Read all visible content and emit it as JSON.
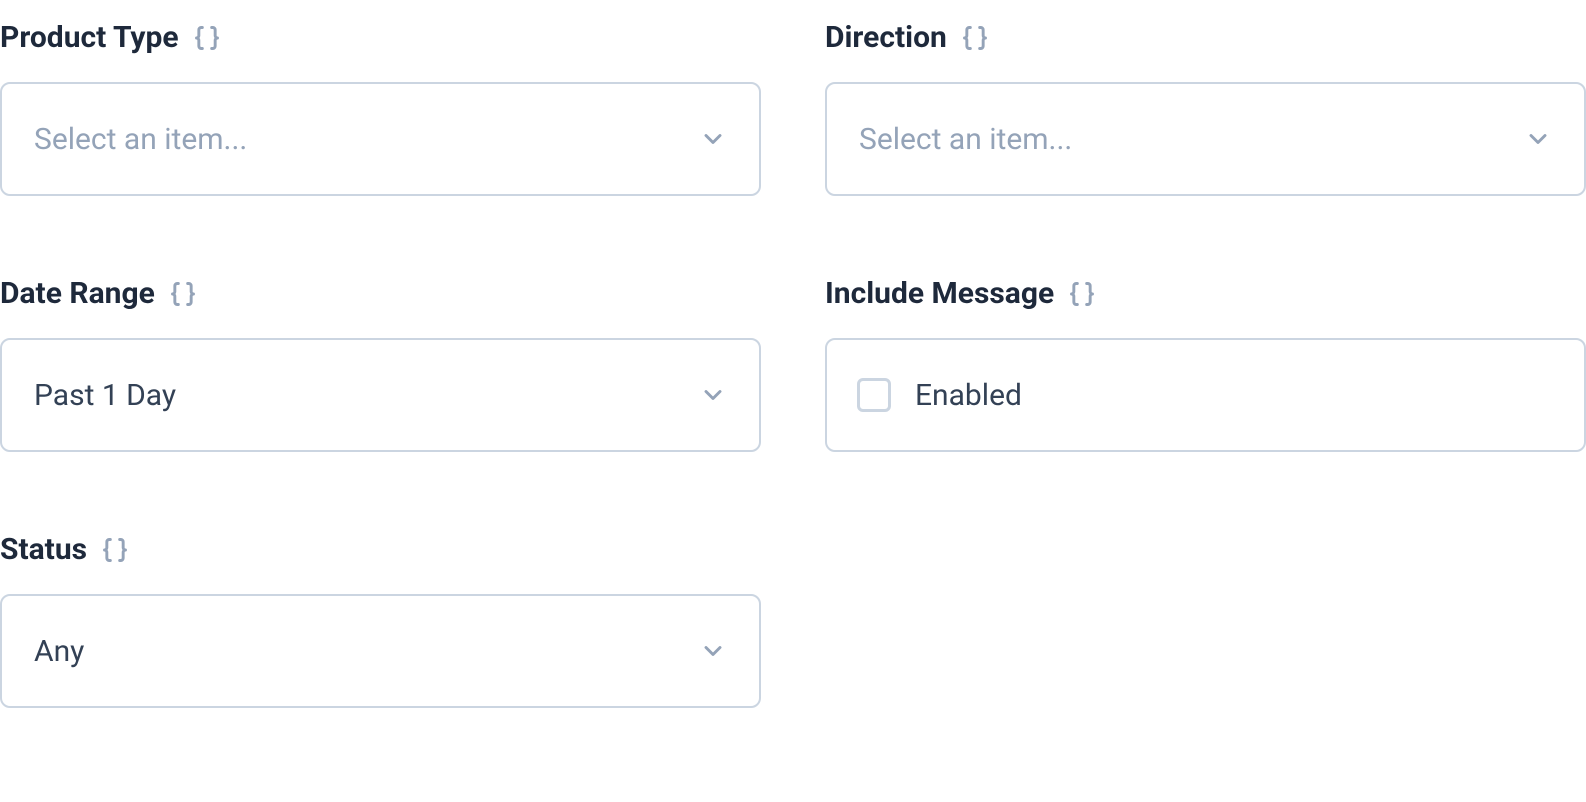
{
  "fields": {
    "productType": {
      "label": "Product Type",
      "placeholder": "Select an item...",
      "value": ""
    },
    "direction": {
      "label": "Direction",
      "placeholder": "Select an item...",
      "value": ""
    },
    "dateRange": {
      "label": "Date Range",
      "value": "Past 1 Day"
    },
    "includeMessage": {
      "label": "Include Message",
      "checkboxLabel": "Enabled",
      "checked": false
    },
    "status": {
      "label": "Status",
      "value": "Any"
    }
  }
}
